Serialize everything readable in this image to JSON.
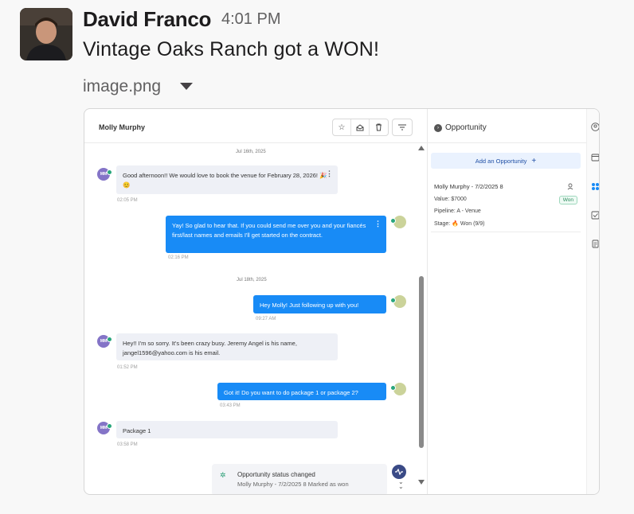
{
  "message": {
    "sender": "David Franco",
    "time": "4:01 PM",
    "text": "Vintage Oaks Ranch got a WON!",
    "attachment_name": "image.png"
  },
  "screenshot": {
    "contact_name": "Molly Murphy",
    "avatar_initials": "MM",
    "conversation": [
      {
        "type": "date",
        "text": "Jul 16th, 2025"
      },
      {
        "type": "in",
        "text": "Good afternoon!! We would love to book the venue for February 28, 2026! 🎉😊",
        "time": "02:05 PM"
      },
      {
        "type": "out",
        "text": "Yay! So glad to hear that. If you could send me over you and your fiancés first/last names and emails I'll get started on the contract.",
        "time": "02:16 PM"
      },
      {
        "type": "date",
        "text": "Jul 18th, 2025"
      },
      {
        "type": "out",
        "text": "Hey Molly! Just following up with you!",
        "time": "09:27 AM"
      },
      {
        "type": "in",
        "text": "Hey!! I'm so sorry. It's been crazy busy. Jeremy Angel is his name, jangel1596@yahoo.com is his email.",
        "time": "01:52 PM"
      },
      {
        "type": "out",
        "text": "Got it! Do you want to do package 1 or package 2?",
        "time": "03:43 PM"
      },
      {
        "type": "in",
        "text": "Package 1",
        "time": "03:58 PM"
      }
    ],
    "status_card": {
      "title": "Opportunity status changed",
      "subtitle": "Molly Murphy - 7/2/2025 8 Marked as won"
    },
    "panel": {
      "title": "Opportunity",
      "add_label": "Add an Opportunity",
      "opportunity": {
        "name": "Molly Murphy - 7/2/2025 8",
        "value": "Value: $7000",
        "pipeline": "Pipeline: A - Venue",
        "stage": "Won (9/9)",
        "stage_label": "Stage:",
        "badge": "Won"
      }
    },
    "colors": {
      "outgoing_bubble": "#188bf6",
      "incoming_bubble": "#eef0f6",
      "won_green": "#2b8a5c",
      "avatar_purple": "#8474c7"
    }
  }
}
